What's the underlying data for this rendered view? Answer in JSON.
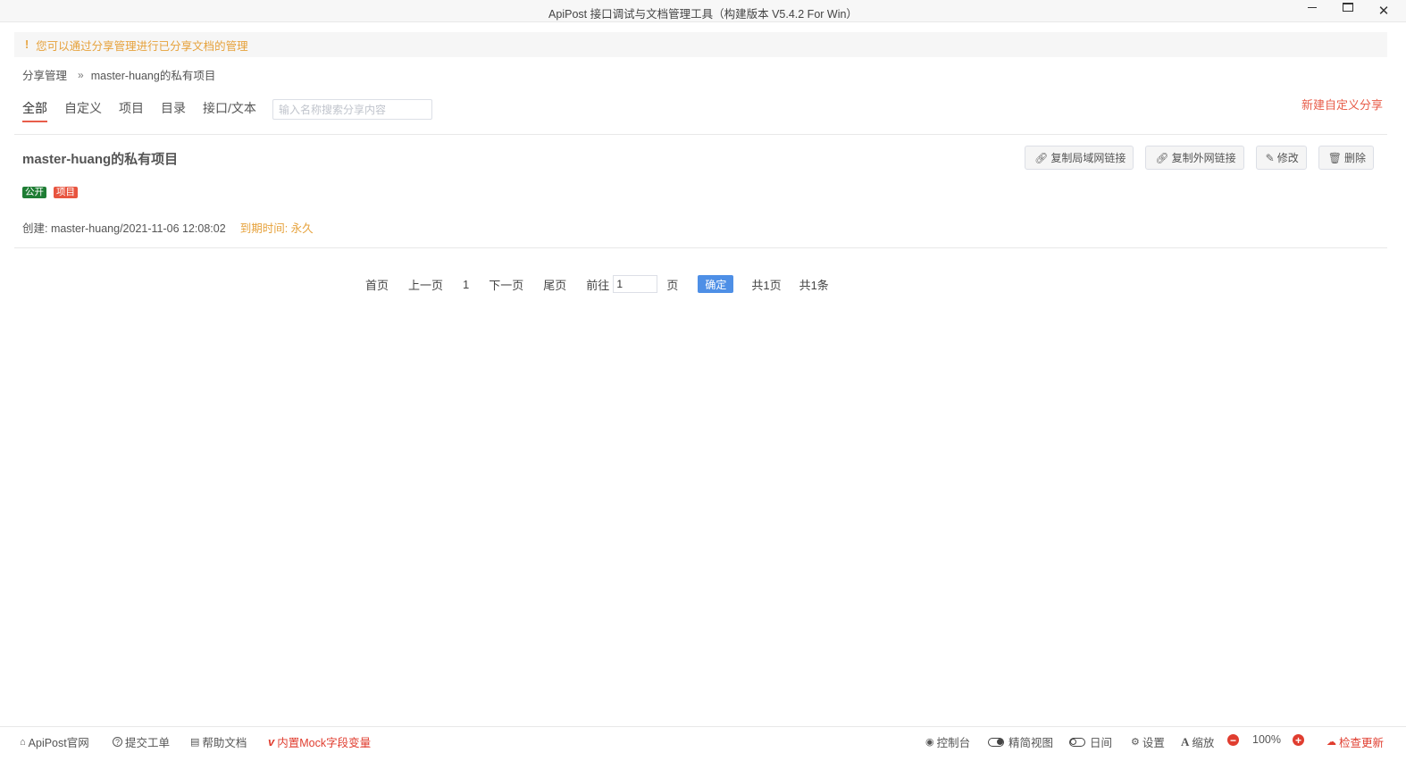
{
  "window": {
    "title": "ApiPost 接口调试与文档管理工具（构建版本 V5.4.2 For Win）",
    "minimize_icon": "minimize-icon",
    "maximize_icon": "maximize-icon",
    "close_icon": "close-icon",
    "close_glyph": "✕"
  },
  "notice": {
    "icon": "exclamation-icon",
    "glyph": "!",
    "text": "您可以通过分享管理进行已分享文档的管理"
  },
  "breadcrumb": {
    "root": "分享管理",
    "separator": "»",
    "current": "master-huang的私有项目"
  },
  "tabs": [
    {
      "label": "全部",
      "active": true
    },
    {
      "label": "自定义",
      "active": false
    },
    {
      "label": "项目",
      "active": false
    },
    {
      "label": "目录",
      "active": false
    },
    {
      "label": "接口/文本",
      "active": false
    }
  ],
  "search": {
    "placeholder": "输入名称搜索分享内容",
    "value": ""
  },
  "new_share_label": "新建自定义分享",
  "share_item": {
    "title": "master-huang的私有项目",
    "tags": {
      "public": "公开",
      "project": "项目"
    },
    "created": "创建: master-huang/2021-11-06 12:08:02",
    "expire": "到期时间: 永久",
    "actions": {
      "copy_lan": {
        "label": "复制局域网链接",
        "icon": "link-icon",
        "glyph": "🔗"
      },
      "copy_wan": {
        "label": "复制外网链接",
        "icon": "link-icon",
        "glyph": "🔗"
      },
      "edit": {
        "label": "修改",
        "icon": "edit-icon",
        "glyph": "✎"
      },
      "delete": {
        "label": "删除",
        "icon": "trash-icon",
        "glyph": "🗑"
      }
    }
  },
  "pagination": {
    "first": "首页",
    "prev": "上一页",
    "current": "1",
    "next": "下一页",
    "last": "尾页",
    "goto_label": "前往",
    "goto_value": "1",
    "goto_unit": "页",
    "confirm": "确定",
    "total_pages": "共1页",
    "total_items": "共1条"
  },
  "footer": {
    "website": {
      "label": "ApiPost官网",
      "icon": "home-icon",
      "glyph": "⌂"
    },
    "ticket": {
      "label": "提交工单",
      "icon": "question-circle-icon",
      "glyph": "?"
    },
    "docs": {
      "label": "帮助文档",
      "icon": "book-icon",
      "glyph": "▤"
    },
    "mock": {
      "label": "内置Mock字段变量",
      "icon": "mock-v-icon",
      "glyph": "v"
    },
    "console": {
      "label": "控制台",
      "icon": "chrome-icon",
      "glyph": "◉"
    },
    "compact": {
      "label": "精简视图",
      "icon": "toggle-on-icon"
    },
    "theme": {
      "label": "日间",
      "icon": "toggle-off-icon"
    },
    "settings": {
      "label": "设置",
      "icon": "gear-icon",
      "glyph": "⚙"
    },
    "zoom_label": {
      "label": "缩放",
      "icon": "font-icon",
      "glyph": "A"
    },
    "zoom_out_glyph": "−",
    "zoom_value": "100%",
    "zoom_in_glyph": "+",
    "update": {
      "label": "检查更新",
      "icon": "cloud-download-icon",
      "glyph": "☁"
    }
  }
}
